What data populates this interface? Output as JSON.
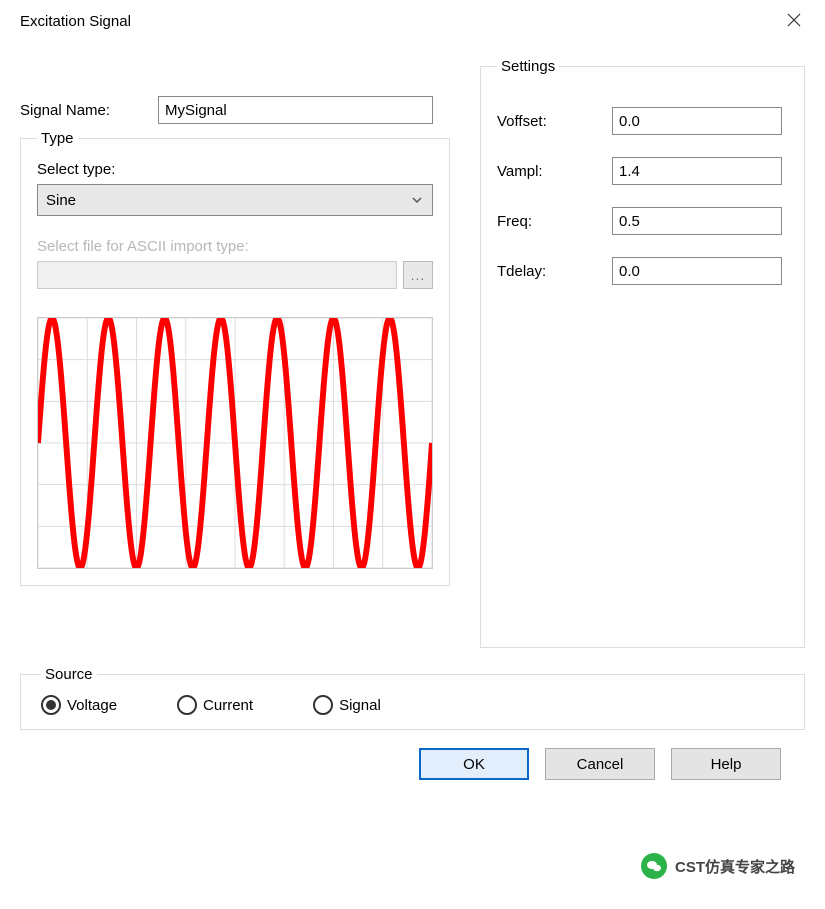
{
  "window": {
    "title": "Excitation Signal"
  },
  "signal_name": {
    "label": "Signal Name:",
    "value": "MySignal"
  },
  "type_group": {
    "legend": "Type",
    "select_label": "Select type:",
    "selected": "Sine",
    "file_label": "Select file for ASCII import type:",
    "file_value": "",
    "browse": "..."
  },
  "settings_group": {
    "legend": "Settings",
    "rows": [
      {
        "label": "Voffset:",
        "value": "0.0"
      },
      {
        "label": "Vampl:",
        "value": "1.4"
      },
      {
        "label": "Freq:",
        "value": "0.5"
      },
      {
        "label": "Tdelay:",
        "value": "0.0"
      }
    ]
  },
  "source_group": {
    "legend": "Source",
    "options": [
      {
        "label": "Voltage",
        "checked": true
      },
      {
        "label": "Current",
        "checked": false
      },
      {
        "label": "Signal",
        "checked": false
      }
    ]
  },
  "buttons": {
    "ok": "OK",
    "cancel": "Cancel",
    "help": "Help"
  },
  "watermark": "CST仿真专家之路",
  "chart_data": {
    "type": "line",
    "title": "",
    "xlabel": "",
    "ylabel": "",
    "xlim": [
      0,
      14
    ],
    "ylim": [
      -1.4,
      1.4
    ],
    "series": [
      {
        "name": "sine",
        "amplitude": 1.4,
        "frequency": 0.5,
        "offset": 0.0,
        "color": "#ff0000"
      }
    ],
    "grid": {
      "x_ticks": 8,
      "y_ticks": 6
    }
  }
}
